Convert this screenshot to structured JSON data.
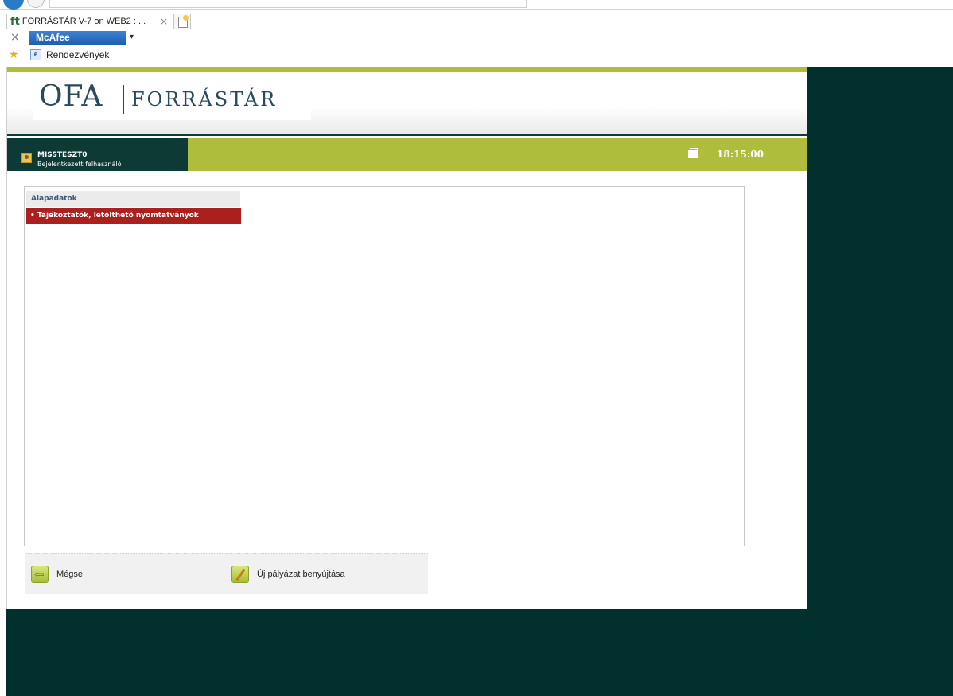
{
  "browser": {
    "tab_favicon": "ft",
    "tab_title": "FORRÁSTÁR V-7 on WEB2 : ...",
    "tab_close": "×",
    "toolbar_close": "×",
    "mcafee_label": "McAfee",
    "mcafee_arrow": "▾",
    "favorites_item": "Rendezvények",
    "favorites_icon": "ie-page-icon"
  },
  "brand": {
    "logo_mark": "OFA",
    "logo_name": "FORRÁSTÁR"
  },
  "user": {
    "name": "MISSTESZT0",
    "role": "Bejelentkezett felhasználó"
  },
  "clock": "18:15:00",
  "section": {
    "title": "Alapadatok",
    "items": [
      {
        "label": "• Tájékoztatók, letölthető nyomtatványok"
      }
    ]
  },
  "actions": {
    "cancel_label": "Mégse",
    "submit_label": "Új pályázat benyújtása"
  },
  "colors": {
    "accent_green": "#b0bc3c",
    "dark_teal": "#01302f",
    "nav_dark": "#0e3a35",
    "menu_red": "#ac1f1f"
  }
}
